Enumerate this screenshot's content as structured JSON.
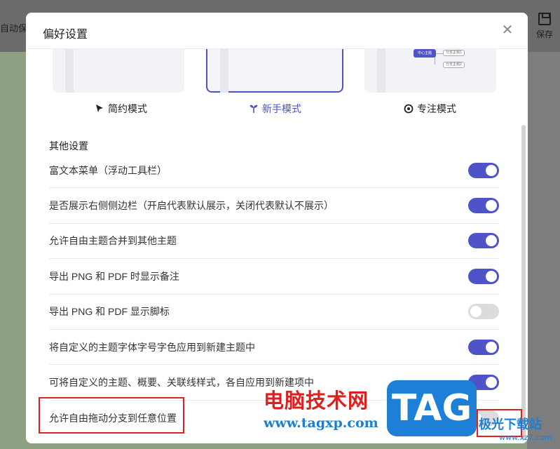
{
  "background": {
    "left_text": "自动保存",
    "save_label": "保存"
  },
  "dialog": {
    "title": "偏好设置",
    "close_glyph": "✕"
  },
  "modes": [
    {
      "label": "简约模式",
      "icon": "cursor-icon",
      "selected": false
    },
    {
      "label": "新手模式",
      "icon": "sprout-icon",
      "selected": true
    },
    {
      "label": "专注模式",
      "icon": "target-icon",
      "selected": false
    }
  ],
  "mode_preview": {
    "center_node": "中心主题",
    "leaf_1": "分支主题1",
    "leaf_2": "分支主题2"
  },
  "section_title": "其他设置",
  "settings": [
    {
      "label": "富文本菜单（浮动工具栏）",
      "enabled": true
    },
    {
      "label": "是否展示右侧侧边栏（开启代表默认展示，关闭代表默认不展示）",
      "enabled": true
    },
    {
      "label": "允许自由主题合并到其他主题",
      "enabled": true
    },
    {
      "label": "导出 PNG 和 PDF 时显示备注",
      "enabled": true
    },
    {
      "label": "导出 PNG 和 PDF 显示脚标",
      "enabled": false
    },
    {
      "label": "将自定义的主题字体字号字色应用到新建主题中",
      "enabled": true
    },
    {
      "label": "可将自定义的主题、概要、关联线样式，各自应用到新建项中",
      "enabled": true
    },
    {
      "label": "允许自由拖动分支到任意位置",
      "enabled": false
    }
  ],
  "watermark": {
    "cn_text": "电脑技术网",
    "url": "www.tagxp.com",
    "tag": "TAG",
    "site": "极光下载站",
    "domain": "www.xz7.com"
  },
  "colors": {
    "accent": "#4e54c8",
    "toggle_off": "#dcdcdc",
    "highlight": "#e02020"
  }
}
